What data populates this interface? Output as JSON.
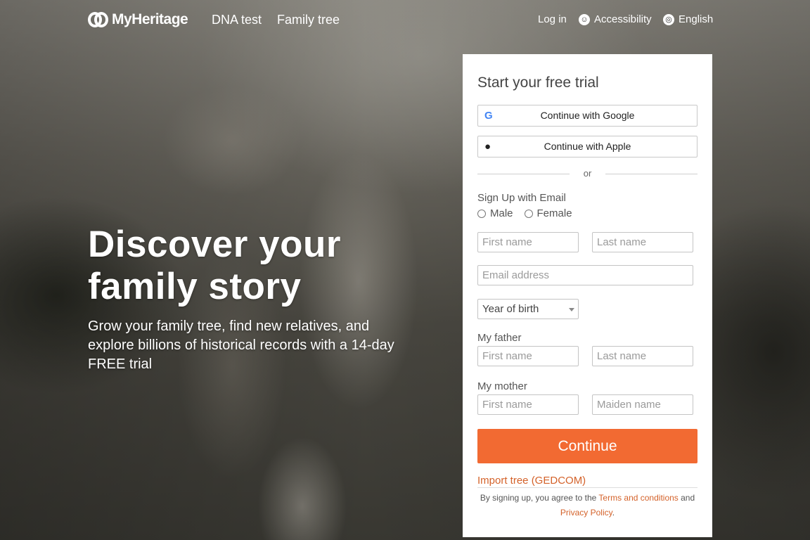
{
  "nav": {
    "logo_text": "MyHeritage",
    "links": [
      "DNA test",
      "Family tree"
    ],
    "login": "Log in",
    "accessibility": "Accessibility",
    "language": "English"
  },
  "hero": {
    "title_line1": "Discover your",
    "title_line2": "family story",
    "subtitle": "Grow your family tree, find new relatives, and explore billions of historical records with a 14-day FREE trial"
  },
  "signup": {
    "title": "Start your free trial",
    "google_label": "Continue with Google",
    "apple_label": "Continue with Apple",
    "or_text": "or",
    "email_section_label": "Sign Up with Email",
    "gender_options": [
      "Male",
      "Female"
    ],
    "first_name_placeholder": "First name",
    "last_name_placeholder": "Last name",
    "email_placeholder": "Email address",
    "year_of_birth": "Year of birth",
    "father_label": "My father",
    "father_first_placeholder": "First name",
    "father_last_placeholder": "Last name",
    "mother_label": "My mother",
    "mother_first_placeholder": "First name",
    "mother_maiden_placeholder": "Maiden name",
    "continue_label": "Continue",
    "import_link": "Import tree (GEDCOM)",
    "terms_prefix": "By signing up, you agree to the ",
    "terms_link": "Terms and conditions",
    "terms_and": " and",
    "privacy_link": "Privacy Policy",
    "terms_suffix": "."
  },
  "colors": {
    "accent": "#f26a32",
    "link": "#d4622a"
  }
}
